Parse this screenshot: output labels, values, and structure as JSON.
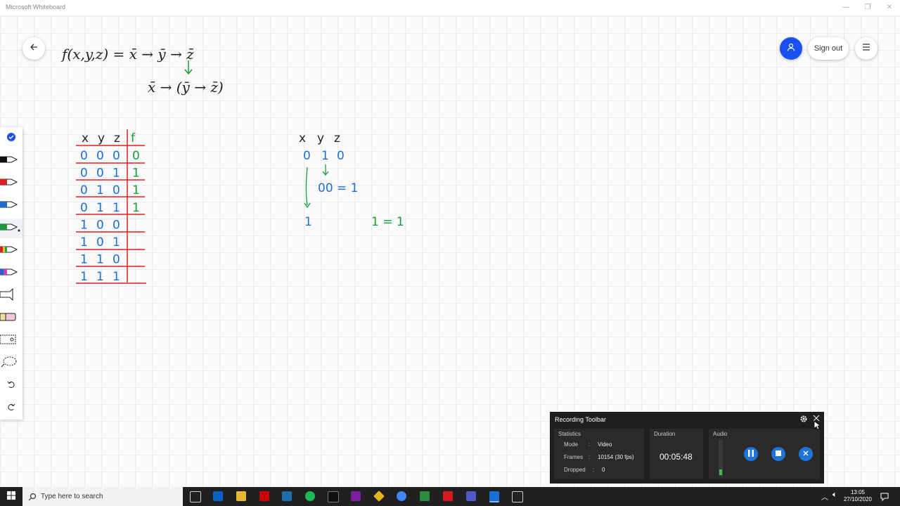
{
  "window": {
    "title": "Microsoft Whiteboard",
    "minimize": "—",
    "restore": "❐",
    "close": "✕"
  },
  "header": {
    "back_icon": "arrow-left-icon",
    "signout_label": "Sign out",
    "user_color": "#1a4ff0"
  },
  "whiteboard": {
    "formula_line1": "f(x,y,z) = x̄ → ȳ → z̄",
    "formula_line2": "x̄ → (ȳ → z̄)",
    "table_header": [
      "x",
      "y",
      "z",
      "f"
    ],
    "table_rows": [
      [
        "0",
        "0",
        "0",
        "0"
      ],
      [
        "0",
        "0",
        "1",
        "1"
      ],
      [
        "0",
        "1",
        "0",
        "1"
      ],
      [
        "0",
        "1",
        "1",
        "1"
      ],
      [
        "1",
        "0",
        "0",
        ""
      ],
      [
        "1",
        "0",
        "1",
        ""
      ],
      [
        "1",
        "1",
        "0",
        ""
      ],
      [
        "1",
        "1",
        "1",
        ""
      ]
    ],
    "eval_header": [
      "x",
      "y",
      "z"
    ],
    "eval_row": [
      "0",
      "1",
      "0"
    ],
    "eval_step1": "00 = 1",
    "eval_step2_left": "1",
    "eval_step2_right": "1 = 1"
  },
  "recording_toolbar": {
    "title": "Recording Toolbar",
    "statistics_label": "Statistics",
    "mode_label": "Mode",
    "mode_value": "Video",
    "frames_label": "Frames",
    "frames_value": "10154 (30 fps)",
    "dropped_label": "Dropped",
    "dropped_value": "0",
    "duration_label": "Duration",
    "duration_value": "00:05:48",
    "audio_label": "Audio",
    "separator": ":"
  },
  "taskbar": {
    "search_placeholder": "Type here to search",
    "time": "13:05",
    "date": "27/10/2020"
  }
}
